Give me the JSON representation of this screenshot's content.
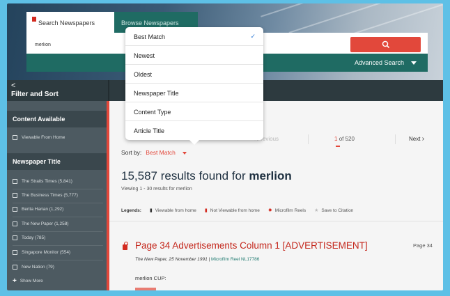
{
  "header": {
    "search_tab_label": "Search Newspapers",
    "browse_tab_label": "Browse Newspapers",
    "search_value": "merlion",
    "advanced_search_label": "Advanced Search"
  },
  "filter_bar": {
    "back_glyph": "<",
    "title": "Filter and Sort"
  },
  "sidebar": {
    "content_available": {
      "heading": "Content Available",
      "items": [
        "Viewable From Home"
      ]
    },
    "newspaper_title": {
      "heading": "Newspaper Title",
      "items": [
        "The Straits Times (5,841)",
        "The Business Times (5,777)",
        "Berita Harian (1,292)",
        "The New Paper (1,258)",
        "Today (785)",
        "Singapore Monitor (554)",
        "New Nation (79)"
      ]
    },
    "show_more_label": "Show More"
  },
  "pagination": {
    "prev_label": "< Previous",
    "current_page": "1",
    "of_label": "of 520",
    "next_label": "Next"
  },
  "sort": {
    "label": "Sort by:",
    "selected": "Best Match",
    "options": [
      {
        "label": "Best Match",
        "selected": true
      },
      {
        "label": "Newest",
        "selected": false
      },
      {
        "label": "Oldest",
        "selected": false
      },
      {
        "label": "Newspaper Title",
        "selected": false
      },
      {
        "label": "Content Type",
        "selected": false
      },
      {
        "label": "Article Title",
        "selected": false
      }
    ]
  },
  "results": {
    "count_text": "15,587 results found for",
    "query": "merlion",
    "viewing_text": "Viewing 1 - 30 results for merlion"
  },
  "legends": {
    "label": "Legends:",
    "items": [
      {
        "label": "Viewable from home",
        "icon": "document-icon"
      },
      {
        "label": "Not Viewable from home",
        "icon": "lock-icon"
      },
      {
        "label": "Microfilm Reels",
        "icon": "film-reel-icon"
      },
      {
        "label": "Save to Citation",
        "icon": "star-icon"
      }
    ]
  },
  "result_item": {
    "title": "Page 34 Advertisements Column 1 [ADVERTISEMENT]",
    "page_label": "Page 34",
    "publication": "The New Paper,  25 November 1991",
    "separator": "|",
    "reel": "Microfilm Reel NL17786",
    "snippet": "merlion CUP:"
  },
  "colors": {
    "accent_red": "#e2483b",
    "teal": "#1f6b63",
    "sidebar_bg": "#4d5a61",
    "link_blue_check": "#2e7bd6"
  }
}
